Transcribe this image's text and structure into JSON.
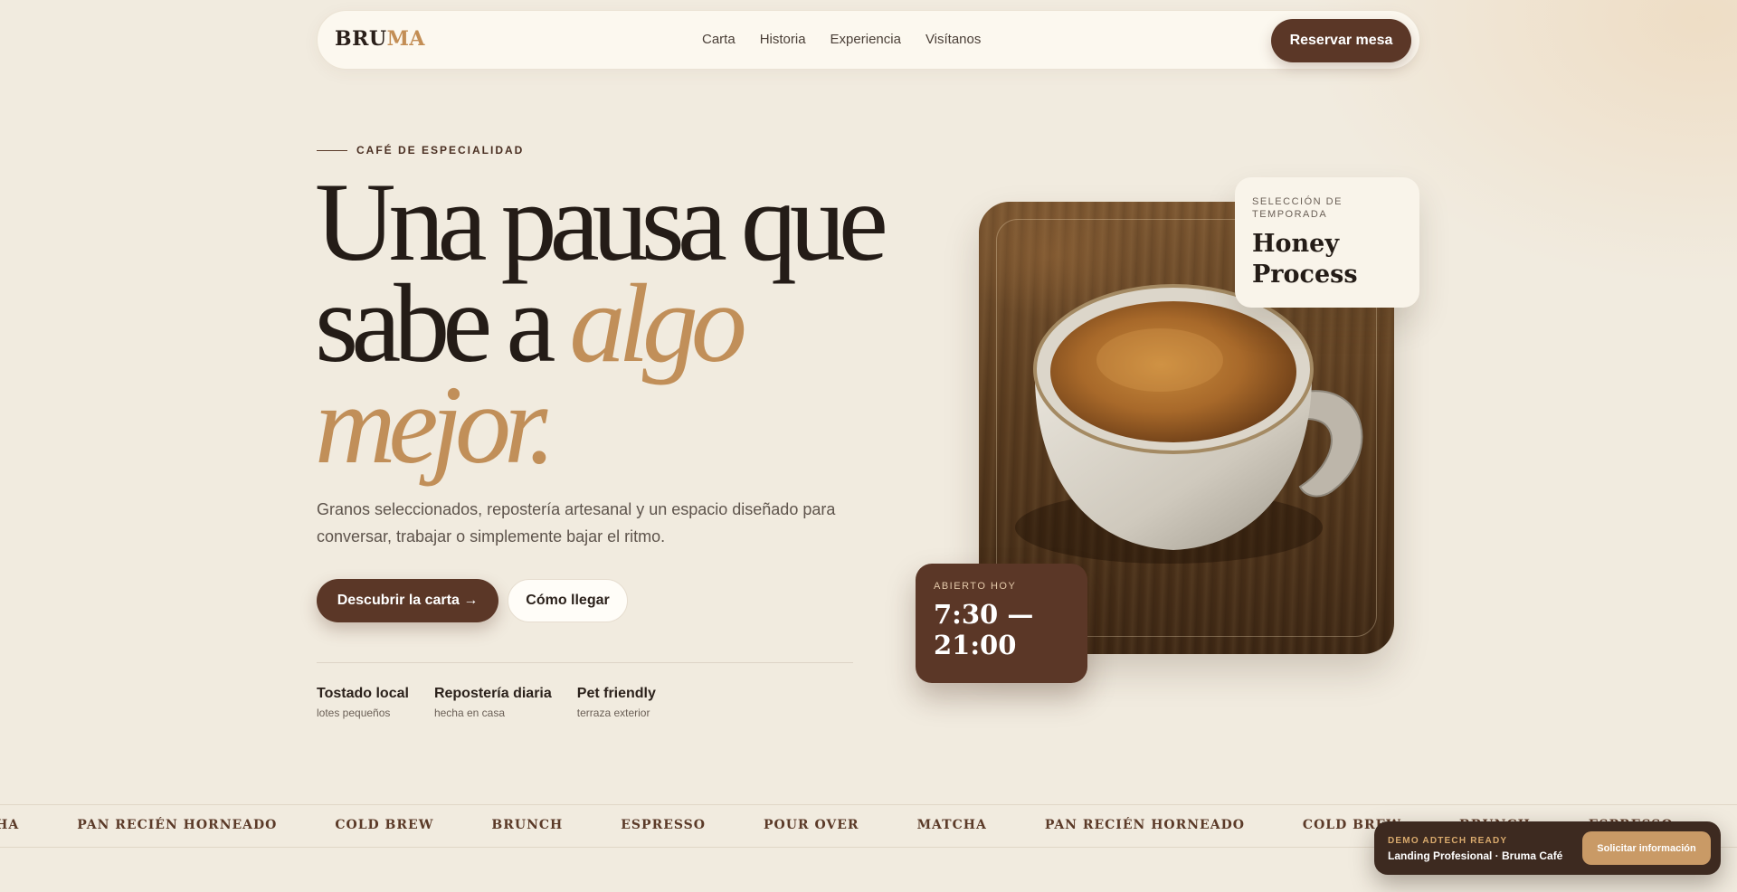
{
  "nav": {
    "logo_primary": "BRU",
    "logo_accent": "MA",
    "links": [
      "Carta",
      "Historia",
      "Experiencia",
      "Visítanos"
    ],
    "cta": "Reservar mesa"
  },
  "hero": {
    "eyebrow": "CAFÉ DE ESPECIALIDAD",
    "headline_line1": "Una pausa que",
    "headline_line2_plain": "sabe a ",
    "headline_line2_italic": "algo",
    "headline_line3_italic": "mejor.",
    "subtitle": "Granos seleccionados, repostería artesanal y un espacio diseñado para conversar, trabajar o simplemente bajar el ritmo.",
    "primary_cta": "Descubrir la carta →",
    "secondary_cta": "Cómo llegar",
    "features": [
      {
        "title": "Tostado local",
        "subtitle": "lotes pequeños"
      },
      {
        "title": "Repostería diaria",
        "subtitle": "hecha en casa"
      },
      {
        "title": "Pet friendly",
        "subtitle": "terraza exterior"
      }
    ]
  },
  "season_card": {
    "label": "SELECCIÓN DE TEMPORADA",
    "value": "Honey Process"
  },
  "hours_card": {
    "label": "ABIERTO HOY",
    "value": "7:30 — 21:00"
  },
  "marquee": {
    "leading_fragment": "MATCHA",
    "items": [
      "PAN RECIÉN HORNEADO",
      "COLD BREW",
      "BRUNCH",
      "ESPRESSO",
      "POUR OVER",
      "MATCHA",
      "PAN RECIÉN HORNEADO",
      "COLD BREW",
      "BRUNCH",
      "ESPRESSO"
    ]
  },
  "demo_bar": {
    "tag": "DEMO ADTECH READY",
    "name": "Landing Profesional · Bruma Café",
    "cta": "Solicitar información"
  },
  "colors": {
    "background": "#f1ebdf",
    "brand_brown": "#5b3727",
    "accent_gold": "#c18f59",
    "text_dark": "#241c17"
  }
}
